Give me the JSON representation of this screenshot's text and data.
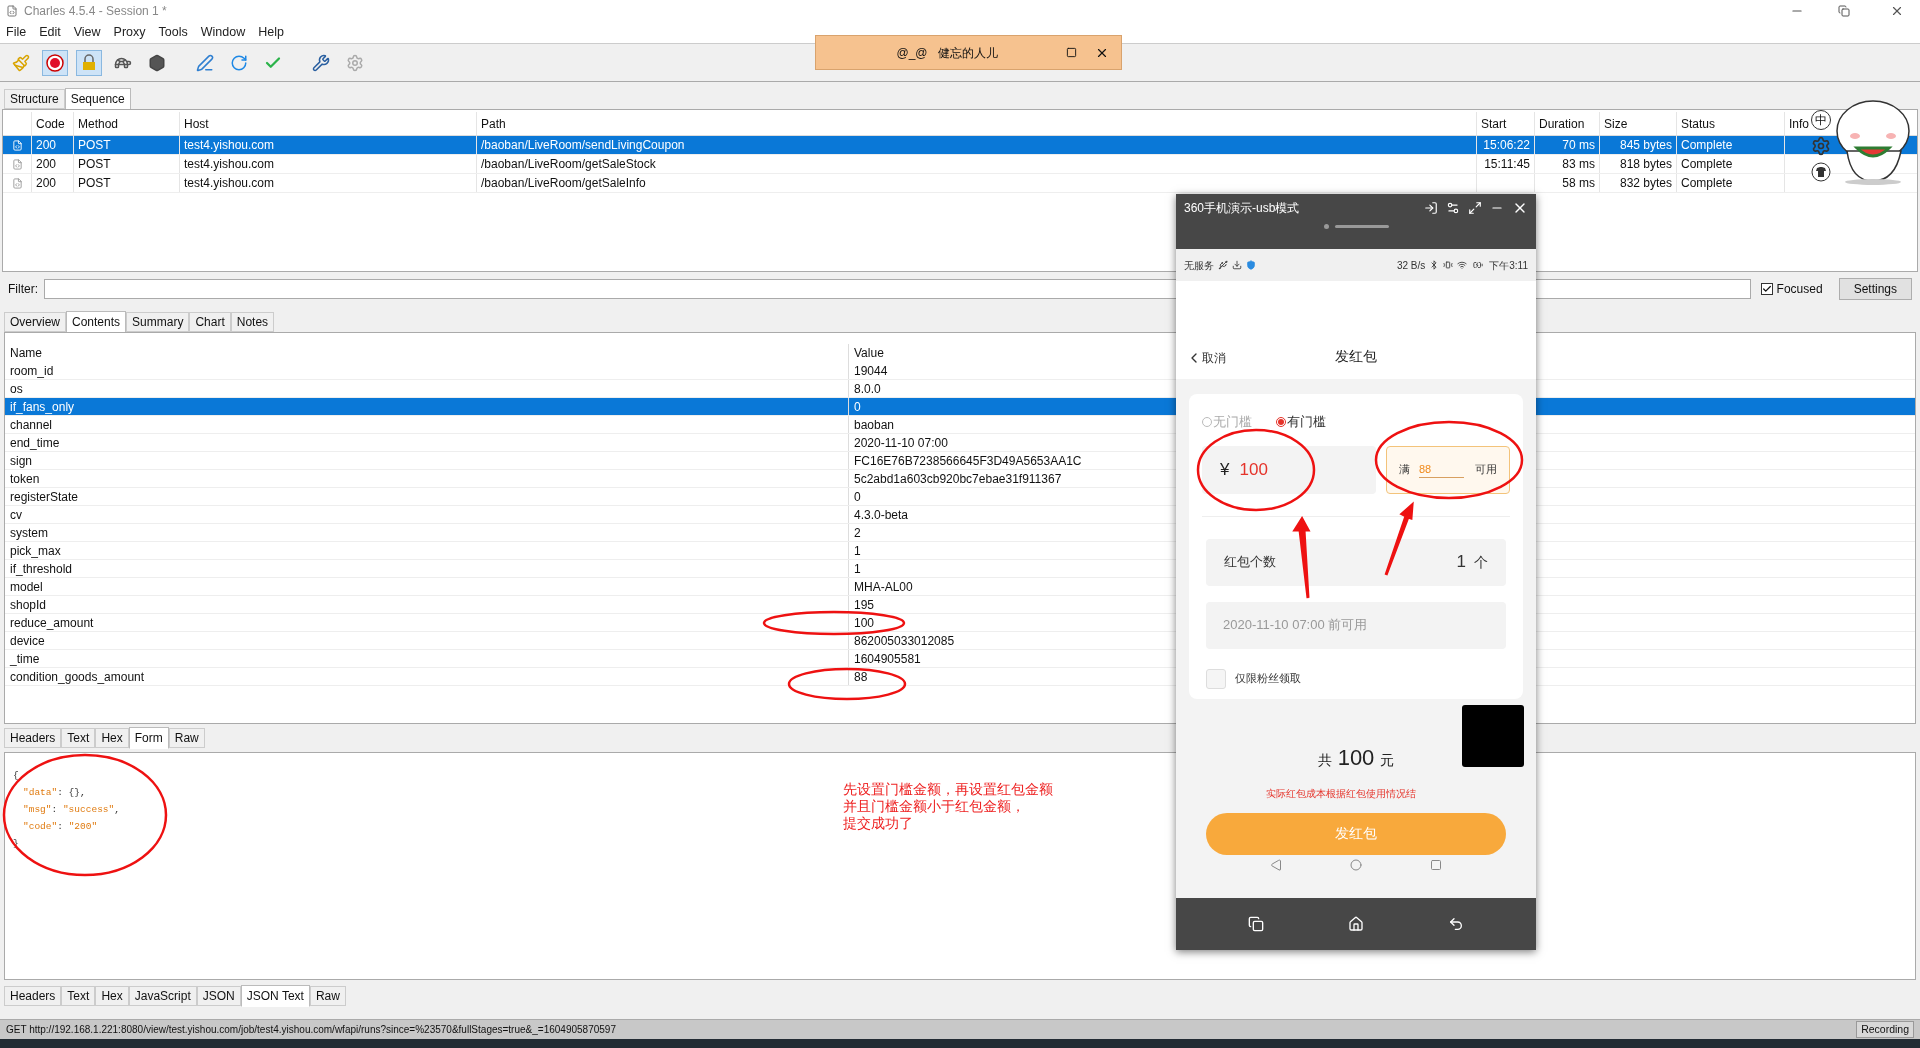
{
  "window": {
    "title": "Charles 4.5.4 - Session 1 *"
  },
  "menu": [
    "File",
    "Edit",
    "View",
    "Proxy",
    "Tools",
    "Window",
    "Help"
  ],
  "toolbar": [
    {
      "kind": "broom",
      "pressed": false
    },
    {
      "kind": "record",
      "pressed": true
    },
    {
      "kind": "throttle",
      "pressed": true
    },
    {
      "kind": "turtle",
      "pressed": false
    },
    {
      "kind": "stop",
      "pressed": false
    },
    {
      "kind": "pen",
      "pressed": false
    },
    {
      "kind": "refresh",
      "pressed": false
    },
    {
      "kind": "check",
      "pressed": false
    },
    {
      "kind": "tools",
      "pressed": false
    },
    {
      "kind": "gear",
      "pressed": false
    }
  ],
  "view_tabs": [
    {
      "label": "Structure",
      "selected": false
    },
    {
      "label": "Sequence",
      "selected": true
    }
  ],
  "requests": {
    "columns": [
      "Code",
      "Method",
      "Host",
      "Path",
      "Start",
      "Duration",
      "Size",
      "Status",
      "Info"
    ],
    "rows": [
      {
        "code": "200",
        "method": "POST",
        "host": "test4.yishou.com",
        "path": "/baoban/LiveRoom/sendLivingCoupon",
        "start": "15:06:22",
        "duration": "70 ms",
        "size": "845 bytes",
        "status": "Complete",
        "selected": true
      },
      {
        "code": "200",
        "method": "POST",
        "host": "test4.yishou.com",
        "path": "/baoban/LiveRoom/getSaleStock",
        "start": "15:11:45",
        "duration": "83 ms",
        "size": "818 bytes",
        "status": "Complete",
        "selected": false
      },
      {
        "code": "200",
        "method": "POST",
        "host": "test4.yishou.com",
        "path": "/baoban/LiveRoom/getSaleInfo",
        "duration": "58 ms",
        "size": "832 bytes",
        "status": "Complete",
        "selected": false
      }
    ]
  },
  "ime": {
    "label": "中"
  },
  "filter": {
    "label": "Filter:",
    "focused": {
      "label": "Focused",
      "checked": true
    },
    "settings": "Settings"
  },
  "detail_tabs": [
    {
      "label": "Overview",
      "selected": false
    },
    {
      "label": "Contents",
      "selected": true
    },
    {
      "label": "Summary",
      "selected": false
    },
    {
      "label": "Chart",
      "selected": false
    },
    {
      "label": "Notes",
      "selected": false
    }
  ],
  "form": {
    "columns": [
      "Name",
      "Value"
    ],
    "rows": [
      {
        "name": "room_id",
        "value": "19044",
        "selected": false
      },
      {
        "name": "os",
        "value": "8.0.0",
        "selected": false
      },
      {
        "name": "if_fans_only",
        "value": "0",
        "selected": true
      },
      {
        "name": "channel",
        "value": "baoban",
        "selected": false
      },
      {
        "name": "end_time",
        "value": "2020-11-10 07:00",
        "selected": false
      },
      {
        "name": "sign",
        "value": "FC16E76B7238566645F3D49A5653AA1C",
        "selected": false
      },
      {
        "name": "token",
        "value": "5c2abd1a603cb920bc7ebae31f911367",
        "selected": false
      },
      {
        "name": "registerState",
        "value": "0",
        "selected": false
      },
      {
        "name": "cv",
        "value": "4.3.0-beta",
        "selected": false
      },
      {
        "name": "system",
        "value": "2",
        "selected": false
      },
      {
        "name": "pick_max",
        "value": "1",
        "selected": false
      },
      {
        "name": "if_threshold",
        "value": "1",
        "selected": false
      },
      {
        "name": "model",
        "value": "MHA-AL00",
        "selected": false
      },
      {
        "name": "shopId",
        "value": "195",
        "selected": false
      },
      {
        "name": "reduce_amount",
        "value": "100",
        "selected": false
      },
      {
        "name": "device",
        "value": "862005033012085",
        "selected": false
      },
      {
        "name": "_time",
        "value": "1604905581",
        "selected": false
      },
      {
        "name": "condition_goods_amount",
        "value": "88",
        "selected": false
      }
    ]
  },
  "request_tabs": [
    {
      "label": "Headers",
      "selected": false
    },
    {
      "label": "Text",
      "selected": false
    },
    {
      "label": "Hex",
      "selected": false
    },
    {
      "label": "Form",
      "selected": true
    },
    {
      "label": "Raw",
      "selected": false
    }
  ],
  "response": {
    "lines": [
      [
        {
          "text": "{",
          "kind": "punct"
        }
      ],
      [
        {
          "text": "\"data\"",
          "kind": "key"
        },
        {
          "text": ": {},",
          "kind": "punct"
        }
      ],
      [
        {
          "text": "\"msg\"",
          "kind": "key"
        },
        {
          "text": ": ",
          "kind": "punct"
        },
        {
          "text": "\"success\"",
          "kind": "string"
        },
        {
          "text": ",",
          "kind": "punct"
        }
      ],
      [
        {
          "text": "\"code\"",
          "kind": "key"
        },
        {
          "text": ": ",
          "kind": "punct"
        },
        {
          "text": "\"200\"",
          "kind": "string"
        }
      ],
      [
        {
          "text": "}",
          "kind": "punct"
        }
      ]
    ]
  },
  "note": [
    "先设置门槛金额，再设置红包金额",
    "并且门槛金额小于红包金额，",
    "提交成功了"
  ],
  "response_tabs": [
    {
      "label": "Headers",
      "selected": false
    },
    {
      "label": "Text",
      "selected": false
    },
    {
      "label": "Hex",
      "selected": false
    },
    {
      "label": "JavaScript",
      "selected": false
    },
    {
      "label": "JSON",
      "selected": false
    },
    {
      "label": "JSON Text",
      "selected": true
    },
    {
      "label": "Raw",
      "selected": false
    }
  ],
  "status_bar": {
    "url": "GET http://192.168.1.221:8080/view/test.yishou.com/job/test4.yishou.com/wfapi/runs?since=%23570&fullStages=true&_=1604905870597",
    "recording": "Recording"
  },
  "popup": {
    "title": "@_@   健忘的人儿"
  },
  "phone": {
    "title": "360手机演示-usb模式",
    "carrier": "无服务",
    "speed": "32 B/s",
    "time": "下午3:11",
    "back": "取消",
    "heading": "发红包",
    "options": [
      {
        "label": "无门槛",
        "selected": false
      },
      {
        "label": "有门槛",
        "selected": true
      }
    ],
    "currency": "¥",
    "amount": "100",
    "threshold_prefix": "满",
    "threshold": "88",
    "threshold_suffix": "可用",
    "count_label": "红包个数",
    "count": "1",
    "count_unit": "个",
    "expiry": "2020-11-10 07:00 前可用",
    "fans_only": {
      "label": "仅限粉丝领取",
      "checked": false
    },
    "total_prefix": "共",
    "total": "100",
    "total_unit": "元",
    "cost_note": "实际红包成本根据红包使用情况结",
    "submit": "发红包"
  }
}
